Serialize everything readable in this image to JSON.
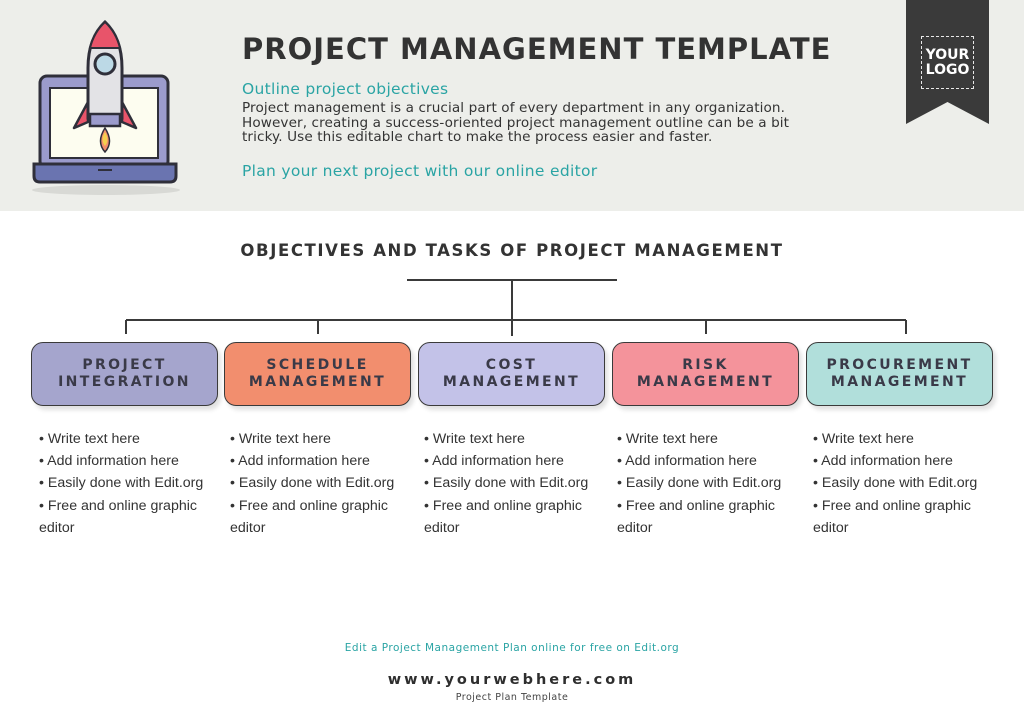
{
  "header": {
    "title": "PROJECT MANAGEMENT TEMPLATE",
    "subtitle": "Outline project objectives",
    "description": "Project management is a crucial part of every department in any organization. However, creating a success-oriented project management outline can be a bit tricky. Use this editable chart to make the process easier and faster.",
    "cta": "Plan your next project with our online editor",
    "illustration_icon": "rocket-laptop-icon",
    "colors": {
      "background": "#edeeea",
      "accent": "#2aa4a4",
      "ribbon": "#3a3a3a"
    }
  },
  "logo": {
    "line1": "YOUR",
    "line2": "LOGO"
  },
  "diagram": {
    "title": "OBJECTIVES AND TASKS OF PROJECT MANAGEMENT",
    "nodes": [
      {
        "line1": "PROJECT",
        "line2": "INTEGRATION",
        "color": "#a5a5cd",
        "items": [
          "• Write text here",
          "• Add information here",
          "• Easily done with Edit.org",
          "• Free and online graphic editor"
        ]
      },
      {
        "line1": "SCHEDULE",
        "line2": "MANAGEMENT",
        "color": "#f28e6e",
        "items": [
          "• Write text here",
          "• Add information here",
          "• Easily done with Edit.org",
          "• Free and online graphic editor"
        ]
      },
      {
        "line1": "COST",
        "line2": "MANAGEMENT",
        "color": "#c3c2e8",
        "items": [
          "• Write text here",
          "• Add information here",
          "• Easily done with Edit.org",
          "• Free and online graphic editor"
        ]
      },
      {
        "line1": "RISK",
        "line2": "MANAGEMENT",
        "color": "#f4939b",
        "items": [
          "• Write text here",
          "• Add information here",
          "• Easily done with Edit.org",
          "• Free and online graphic editor"
        ]
      },
      {
        "line1": "PROCUREMENT",
        "line2": "MANAGEMENT",
        "color": "#b1dfdb",
        "items": [
          "• Write text here",
          "• Add information here",
          "• Easily done with Edit.org",
          "• Free and online graphic editor"
        ]
      }
    ]
  },
  "footer": {
    "link": "Edit a Project Management Plan online for free on Edit.org",
    "website": "www.yourwebhere.com",
    "caption": "Project Plan Template"
  }
}
